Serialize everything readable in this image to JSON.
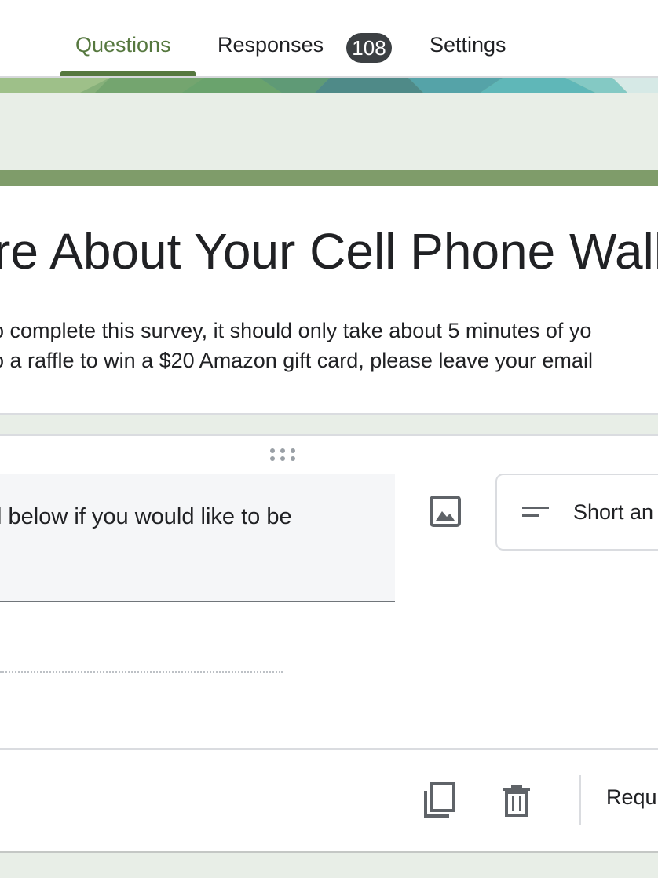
{
  "tabs": {
    "questions_label": "Questions",
    "responses_label": "Responses",
    "responses_count": "108",
    "settings_label": "Settings"
  },
  "form": {
    "title_visible": "re About Your Cell Phone Wall",
    "description_line1": "o complete this survey, it should only take about 5 minutes of yo",
    "description_line2": "o a raffle to win a $20 Amazon gift card, please leave your email"
  },
  "question": {
    "text_visible": "l below if you would like to be",
    "type_label": "Short an",
    "required_label": "Requ"
  },
  "colors": {
    "accent": "#56783f",
    "header_bar": "#7f9c6a",
    "background": "#e8eee7"
  },
  "icons": {
    "image": "image-icon",
    "short_answer": "short-answer-icon",
    "copy": "copy-icon",
    "delete": "delete-icon",
    "drag": "drag-handle-icon"
  }
}
